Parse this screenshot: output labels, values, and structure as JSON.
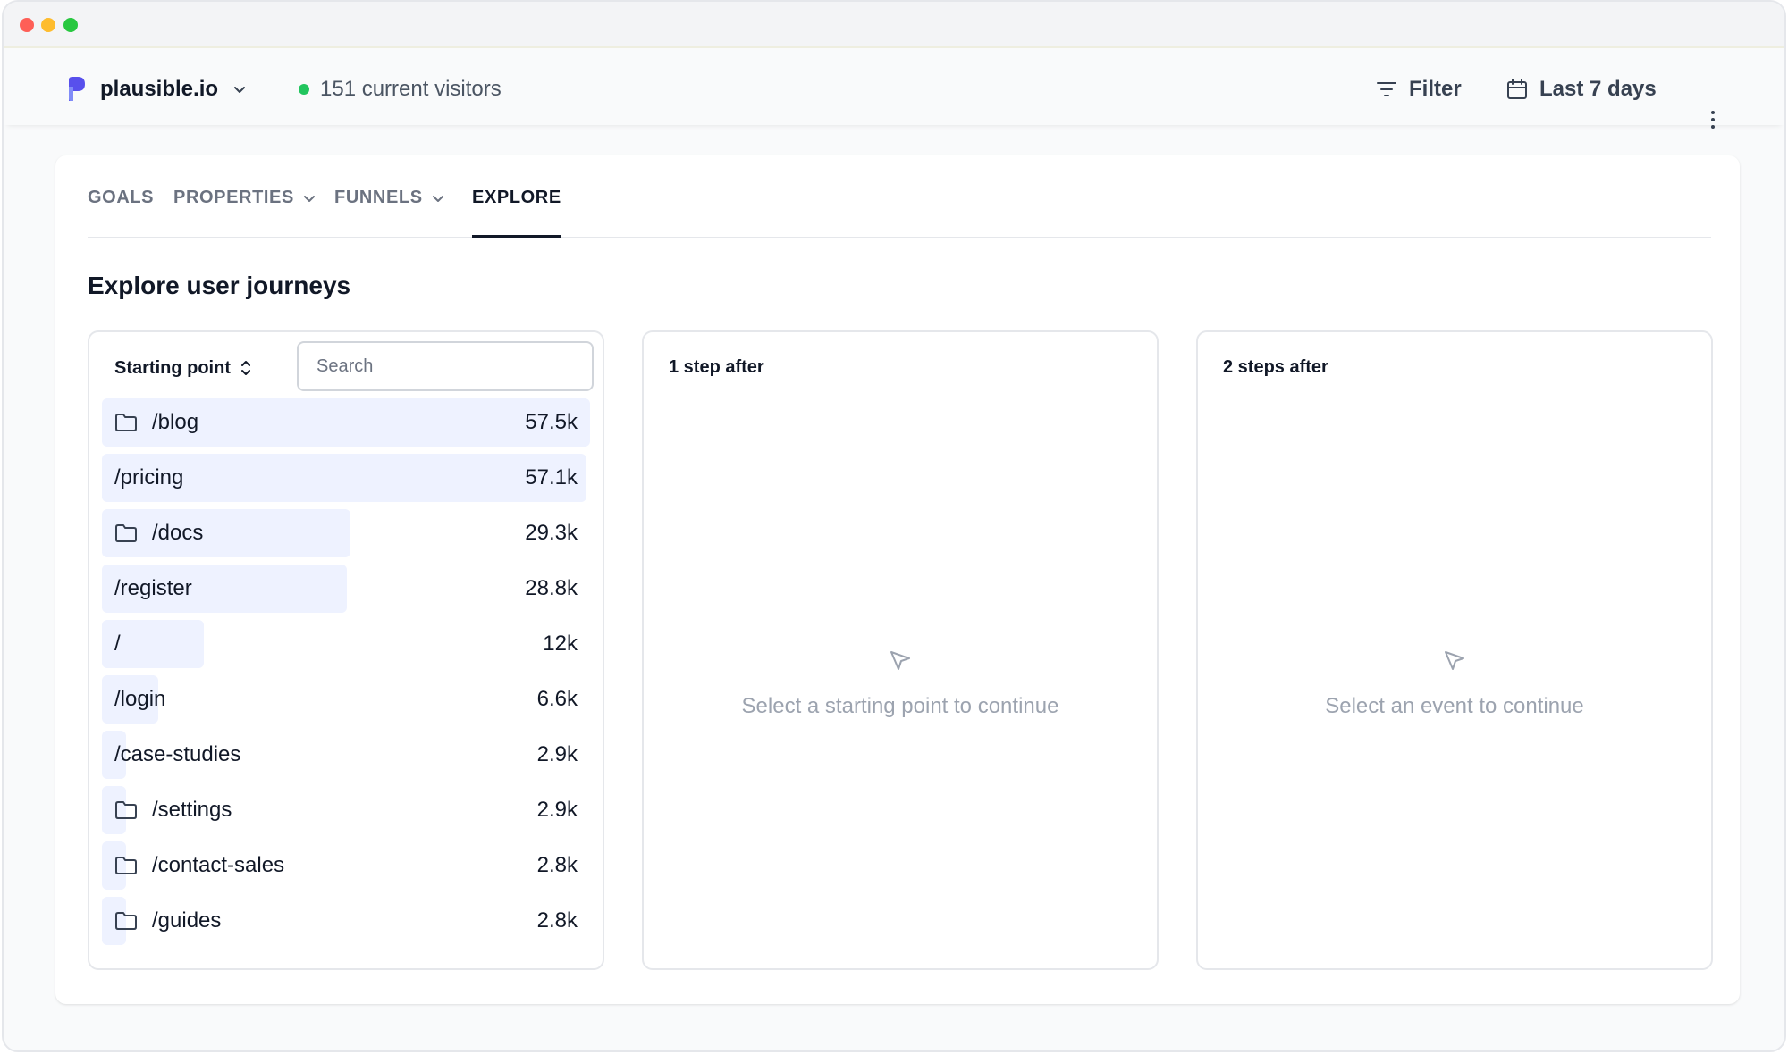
{
  "header": {
    "site_name": "plausible.io",
    "visitors_text": "151 current visitors",
    "filter_label": "Filter",
    "date_range_label": "Last 7 days"
  },
  "tabs": [
    {
      "label": "GOALS",
      "has_dropdown": false,
      "active": false
    },
    {
      "label": "PROPERTIES",
      "has_dropdown": true,
      "active": false
    },
    {
      "label": "FUNNELS",
      "has_dropdown": true,
      "active": false
    },
    {
      "label": "EXPLORE",
      "has_dropdown": false,
      "active": true
    }
  ],
  "section_title": "Explore user journeys",
  "start_panel": {
    "title": "Starting point",
    "search_placeholder": "Search",
    "rows": [
      {
        "label": "/blog",
        "value": "57.5k",
        "icon": "folder-icon",
        "fraction": 1.0
      },
      {
        "label": "/pricing",
        "value": "57.1k",
        "icon": null,
        "fraction": 0.993
      },
      {
        "label": "/docs",
        "value": "29.3k",
        "icon": "folder-icon",
        "fraction": 0.51
      },
      {
        "label": "/register",
        "value": "28.8k",
        "icon": null,
        "fraction": 0.501
      },
      {
        "label": "/",
        "value": "12k",
        "icon": null,
        "fraction": 0.209
      },
      {
        "label": "/login",
        "value": "6.6k",
        "icon": null,
        "fraction": 0.115
      },
      {
        "label": "/case-studies",
        "value": "2.9k",
        "icon": null,
        "fraction": 0.05
      },
      {
        "label": "/settings",
        "value": "2.9k",
        "icon": "folder-icon",
        "fraction": 0.05
      },
      {
        "label": "/contact-sales",
        "value": "2.8k",
        "icon": "folder-icon",
        "fraction": 0.049
      },
      {
        "label": "/guides",
        "value": "2.8k",
        "icon": "folder-icon",
        "fraction": 0.049
      }
    ]
  },
  "step1_panel": {
    "title": "1 step after",
    "empty_text": "Select a starting point to continue"
  },
  "step2_panel": {
    "title": "2 steps after",
    "empty_text": "Select an event to continue"
  },
  "colors": {
    "accent": "#111827",
    "bar": "#eef2ff",
    "live_dot": "#22c55e",
    "logo_primary": "#5850ec",
    "logo_secondary": "#818cf8"
  }
}
